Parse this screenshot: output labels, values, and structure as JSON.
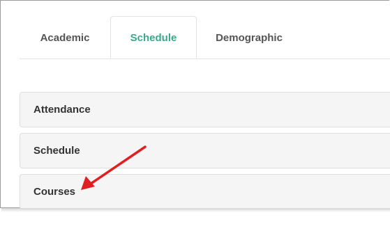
{
  "tabs": [
    {
      "label": "Academic",
      "active": false
    },
    {
      "label": "Schedule",
      "active": true
    },
    {
      "label": "Demographic",
      "active": false
    }
  ],
  "panels": [
    {
      "label": "Attendance"
    },
    {
      "label": "Schedule"
    },
    {
      "label": "Courses"
    }
  ],
  "colors": {
    "active_tab": "#39a98a",
    "annotation_arrow": "#e02020",
    "panel_background": "#f5f5f5"
  },
  "annotation": {
    "icon": "red-arrow-icon",
    "points_to": "Courses"
  }
}
